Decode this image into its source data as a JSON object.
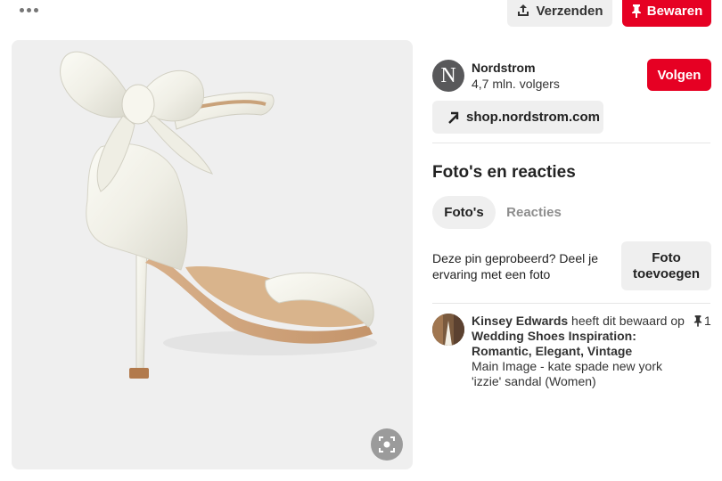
{
  "toolbar": {
    "more_icon": "more-horizontal-icon",
    "send_label": "Verzenden",
    "save_label": "Bewaren",
    "colors": {
      "save": "#e60023",
      "neutral": "#efefef"
    }
  },
  "pin": {
    "image": "white satin bow ankle-strap sandal",
    "lens_icon": "visual-search-icon"
  },
  "profile": {
    "avatar_letter": "N",
    "name": "Nordstrom",
    "followers": "4,7 mln. volgers",
    "follow_label": "Volgen",
    "link_label": "shop.nordstrom.com"
  },
  "photos_section": {
    "title": "Foto's en reacties",
    "tabs": [
      {
        "label": "Foto's",
        "active": true
      },
      {
        "label": "Reacties",
        "active": false
      }
    ],
    "tried_text": "Deze pin geprobeerd? Deel je ervaring met een foto",
    "add_photo_label": "Foto toevoegen"
  },
  "activity": {
    "user": "Kinsey Edwards",
    "action": "heeft dit bewaard",
    "preposition": "op",
    "board": "Wedding Shoes Inspiration: Romantic, Elegant, Vintage",
    "description": "Main Image - kate spade new york 'izzie' sandal (Women)",
    "save_count": "1"
  }
}
